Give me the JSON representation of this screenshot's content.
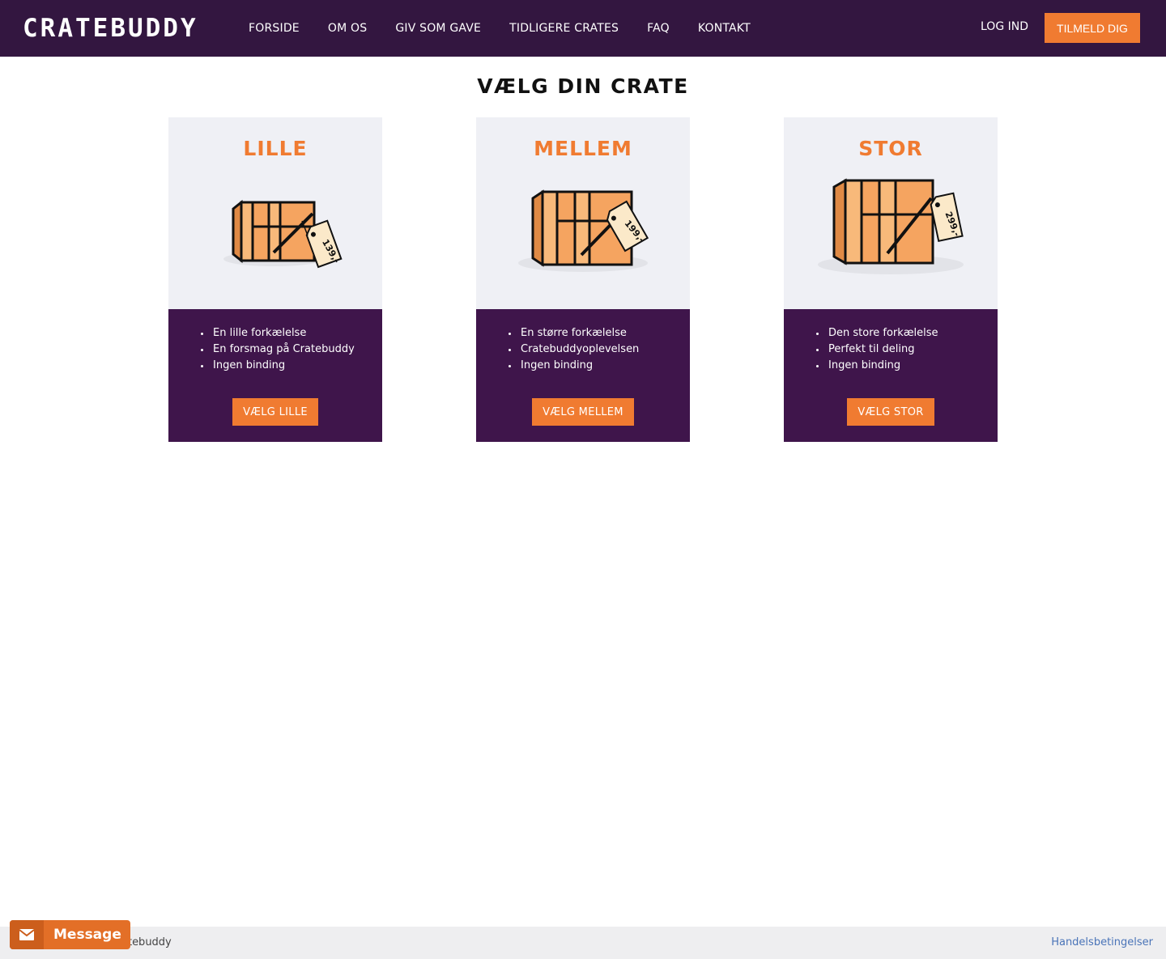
{
  "header": {
    "logo": "CRATEBUDDY",
    "nav": [
      "FORSIDE",
      "OM OS",
      "GIV SOM GAVE",
      "TIDLIGERE CRATES",
      "FAQ",
      "KONTAKT"
    ],
    "login_label": "LOG IND",
    "signup_label": "TILMELD DIG"
  },
  "main": {
    "title": "VÆLG DIN CRATE",
    "plans": [
      {
        "name": "LILLE",
        "price_tag": "139,-",
        "features": [
          "En lille forkælelse",
          "En forsmag på Cratebuddy",
          "Ingen binding"
        ],
        "button_label": "VÆLG LILLE"
      },
      {
        "name": "MELLEM",
        "price_tag": "199,-",
        "features": [
          "En større forkælelse",
          "Cratebuddyoplevelsen",
          "Ingen binding"
        ],
        "button_label": "VÆLG MELLEM"
      },
      {
        "name": "STOR",
        "price_tag": "299,-",
        "features": [
          "Den store forkælelse",
          "Perfekt til deling",
          "Ingen binding"
        ],
        "button_label": "VÆLG STOR"
      }
    ]
  },
  "footer": {
    "copyright": "atebuddy",
    "terms_link": "Handelsbetingelser"
  },
  "message_widget": {
    "label": "Message",
    "icon": "envelope-icon"
  },
  "colors": {
    "header_bg": "#331640",
    "accent": "#f07b31",
    "card_bottom_bg": "#3f154b",
    "card_top_bg": "#eff0f5"
  }
}
